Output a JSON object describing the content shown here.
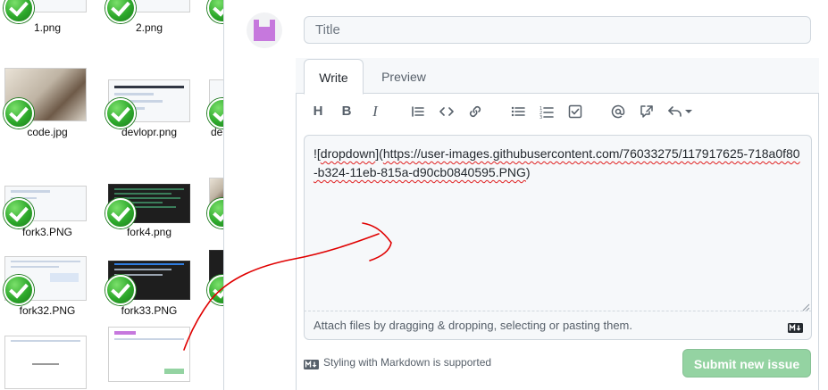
{
  "explorer": {
    "files": [
      {
        "name": "1.png"
      },
      {
        "name": "2.png"
      },
      {
        "name": "code.jpg"
      },
      {
        "name": "devlopr.png"
      },
      {
        "name": "de"
      },
      {
        "name": "fork3.PNG"
      },
      {
        "name": "fork4.png"
      },
      {
        "name": "fork32.PNG"
      },
      {
        "name": "fork33.PNG"
      }
    ]
  },
  "issue_form": {
    "title_placeholder": "Title",
    "tabs": [
      {
        "label": "Write",
        "active": true
      },
      {
        "label": "Preview",
        "active": false
      }
    ],
    "toolbar": [
      {
        "icon": "heading-icon",
        "glyph": "H"
      },
      {
        "icon": "bold-icon",
        "glyph": "B"
      },
      {
        "icon": "italic-icon",
        "glyph": "I"
      },
      {
        "icon": "quote-icon"
      },
      {
        "icon": "code-icon"
      },
      {
        "icon": "link-icon"
      },
      {
        "icon": "unordered-list-icon"
      },
      {
        "icon": "ordered-list-icon"
      },
      {
        "icon": "task-list-icon"
      },
      {
        "icon": "mention-icon"
      },
      {
        "icon": "cross-reference-icon"
      },
      {
        "icon": "reply-icon"
      }
    ],
    "body_text": {
      "part1": "![",
      "part2": "dropdown",
      "part3": "](",
      "part4": "https://user-images.githubusercontent.com/76033275/117917625-718a0f80-b324-11eb-815a-d90cb0840595.PNG",
      "part5": ")"
    },
    "attach_hint": "Attach files by dragging & dropping, selecting or pasting them.",
    "markdown_note": "Styling with Markdown is supported",
    "submit_label": "Submit new issue"
  },
  "colors": {
    "submit_disabled": "#94d3a2",
    "annotation_arrow": "#e00000",
    "check_green": "#2da82b"
  }
}
